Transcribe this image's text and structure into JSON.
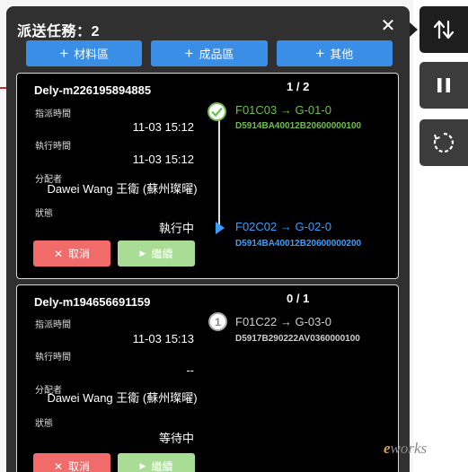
{
  "panel": {
    "title": "派送任務：2",
    "close_label": "✕",
    "area_buttons": [
      {
        "label": "材料區"
      },
      {
        "label": "成品區"
      },
      {
        "label": "其他"
      }
    ]
  },
  "labels": {
    "assigned_time": "指派時間",
    "exec_time": "執行時間",
    "assigner": "分配者",
    "status": "狀態",
    "cancel": "取消",
    "continue": "繼續"
  },
  "tasks": [
    {
      "id": "Dely-m226195894885",
      "progress": "1 / 2",
      "assigned_time": "11-03 15:12",
      "exec_time": "11-03 15:12",
      "assigner": "Dawei Wang 王衛 (蘇州璨曜)",
      "status": "執行中",
      "steps": [
        {
          "route": "F01C03 → G-01-0",
          "code": "D5914BA40012B20600000100",
          "state": "done"
        },
        {
          "route": "F02C02 → G-02-0",
          "code": "D5914BA40012B20600000200",
          "state": "active"
        }
      ]
    },
    {
      "id": "Dely-m194656691159",
      "progress": "0 / 1",
      "assigned_time": "11-03 15:13",
      "exec_time": "--",
      "assigner": "Dawei Wang 王衛 (蘇州璨曜)",
      "status": "等待中",
      "steps": [
        {
          "route": "F01C22 → G-03-0",
          "code": "D5917B290222AV0360000100",
          "state": "pending",
          "index": "1"
        }
      ]
    }
  ],
  "colors": {
    "panel_bg": "#303030",
    "accent_blue": "#3a8ee6",
    "cancel_red": "#f26b6b",
    "continue_green": "#a9dd96",
    "done_green": "#6cc04a",
    "active_blue": "#3b9eff"
  },
  "icons": {
    "tool1": "swap-route-icon",
    "tool2": "pause-icon",
    "tool3": "refresh-icon"
  },
  "watermark": {
    "brand": "e",
    "rest": "works"
  }
}
